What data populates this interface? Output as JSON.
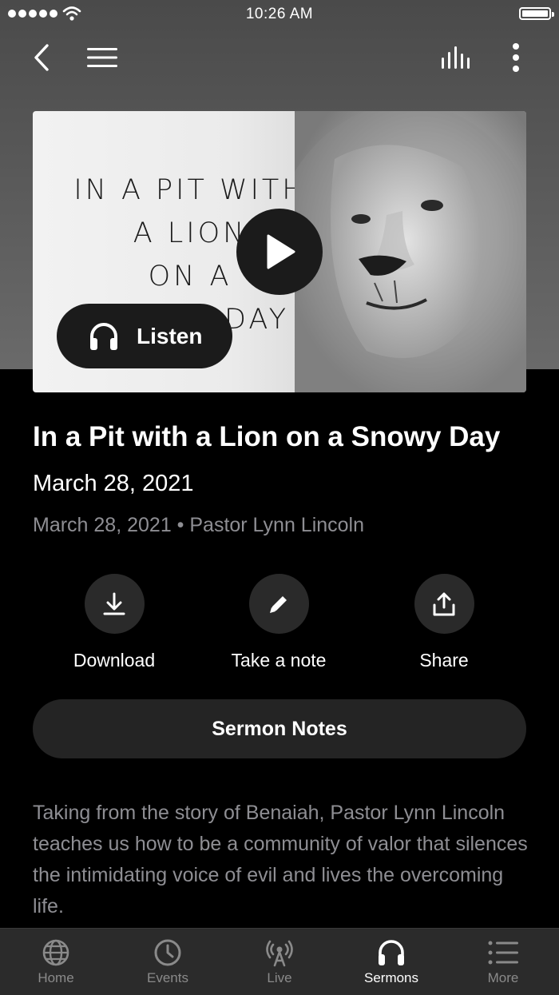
{
  "status_bar": {
    "time": "10:26 AM"
  },
  "artwork": {
    "text": "IN A PIT WITH\nA LION\nON A\nSNOWY DAY",
    "listen_label": "Listen"
  },
  "sermon": {
    "title": "In a Pit with a Lion on a Snowy Day",
    "date": "March 28, 2021",
    "meta": "March 28, 2021 • Pastor Lynn Lincoln",
    "description": "Taking from the story of Benaiah, Pastor Lynn Lincoln teaches us how to be a community of valor that silences the intimidating voice of evil and lives the overcoming life."
  },
  "actions": [
    {
      "label": "Download",
      "icon": "download-icon"
    },
    {
      "label": "Take a note",
      "icon": "pencil-icon"
    },
    {
      "label": "Share",
      "icon": "share-icon"
    }
  ],
  "notes_button": "Sermon Notes",
  "tabs": [
    {
      "label": "Home",
      "icon": "globe-icon",
      "active": false
    },
    {
      "label": "Events",
      "icon": "clock-icon",
      "active": false
    },
    {
      "label": "Live",
      "icon": "broadcast-icon",
      "active": false
    },
    {
      "label": "Sermons",
      "icon": "headphones-icon",
      "active": true
    },
    {
      "label": "More",
      "icon": "list-icon",
      "active": false
    }
  ],
  "colors": {
    "background": "#000000",
    "header_gray": "#5a5a5a",
    "button_dark": "#242424",
    "muted_text": "#8e8e93",
    "tab_bar": "#2b2b2b"
  }
}
